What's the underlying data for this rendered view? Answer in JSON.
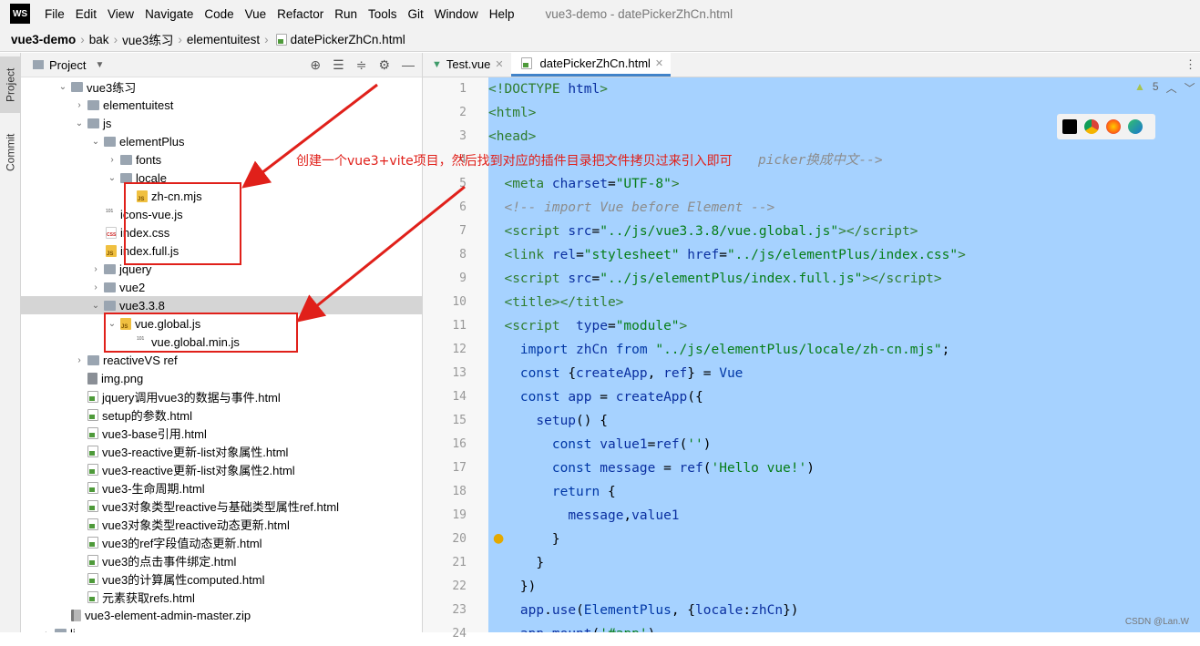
{
  "menubar": {
    "logo": "WS",
    "items": [
      "File",
      "Edit",
      "View",
      "Navigate",
      "Code",
      "Vue",
      "Refactor",
      "Run",
      "Tools",
      "Git",
      "Window",
      "Help"
    ],
    "title": "vue3-demo - datePickerZhCn.html"
  },
  "breadcrumb": [
    "vue3-demo",
    "bak",
    "vue3练习",
    "elementuitest",
    "datePickerZhCn.html"
  ],
  "side_tabs": {
    "project": "Project",
    "commit": "Commit"
  },
  "project_panel": {
    "title": "Project"
  },
  "tree": [
    {
      "name": "vue3练习",
      "type": "folder",
      "open": true
    },
    {
      "name": "elementuitest",
      "type": "folder",
      "open": false
    },
    {
      "name": "js",
      "type": "folder",
      "open": true
    },
    {
      "name": "elementPlus",
      "type": "folder",
      "open": true
    },
    {
      "name": "fonts",
      "type": "folder",
      "open": false
    },
    {
      "name": "locale",
      "type": "folder",
      "open": true
    },
    {
      "name": "zh-cn.mjs",
      "type": "js"
    },
    {
      "name": "icons-vue.js",
      "type": "bin"
    },
    {
      "name": "index.css",
      "type": "css"
    },
    {
      "name": "index.full.js",
      "type": "js"
    },
    {
      "name": "jquery",
      "type": "folder",
      "open": false
    },
    {
      "name": "vue2",
      "type": "folder",
      "open": false
    },
    {
      "name": "vue3.3.8",
      "type": "folder",
      "open": true,
      "selected": true
    },
    {
      "name": "vue.global.js",
      "type": "js",
      "open": true
    },
    {
      "name": "vue.global.min.js",
      "type": "bin"
    },
    {
      "name": "reactiveVS ref",
      "type": "folder",
      "open": false
    },
    {
      "name": "img.png",
      "type": "png"
    },
    {
      "name": "jquery调用vue3的数据与事件.html",
      "type": "html"
    },
    {
      "name": "setup的参数.html",
      "type": "html"
    },
    {
      "name": "vue3-base引用.html",
      "type": "html"
    },
    {
      "name": "vue3-reactive更新-list对象属性.html",
      "type": "html"
    },
    {
      "name": "vue3-reactive更新-list对象属性2.html",
      "type": "html"
    },
    {
      "name": "vue3-生命周期.html",
      "type": "html"
    },
    {
      "name": "vue3对象类型reactive与基础类型属性ref.html",
      "type": "html"
    },
    {
      "name": "vue3对象类型reactive动态更新.html",
      "type": "html"
    },
    {
      "name": "vue3的ref字段值动态更新.html",
      "type": "html"
    },
    {
      "name": "vue3的点击事件绑定.html",
      "type": "html"
    },
    {
      "name": "vue3的计算属性computed.html",
      "type": "html"
    },
    {
      "name": "元素获取refs.html",
      "type": "html"
    },
    {
      "name": "vue3-element-admin-master.zip",
      "type": "zip"
    },
    {
      "name": "li",
      "type": "folder",
      "open": false
    }
  ],
  "tabs": [
    {
      "label": "Test.vue"
    },
    {
      "label": "datePickerZhCn.html",
      "active": true
    }
  ],
  "editor_status": {
    "warnings": "5"
  },
  "line_numbers": [
    "1",
    "2",
    "3",
    "4",
    "5",
    "6",
    "7",
    "8",
    "9",
    "10",
    "11",
    "12",
    "13",
    "14",
    "15",
    "16",
    "17",
    "18",
    "19",
    "20",
    "21",
    "22",
    "23",
    "24"
  ],
  "annotation": "创建一个vue3+vite项目，然后找到对应的插件目录把文件拷贝过来引入即可",
  "code_line4_tail": "picker换成中文-->",
  "watermark": "CSDN @Lan.W"
}
